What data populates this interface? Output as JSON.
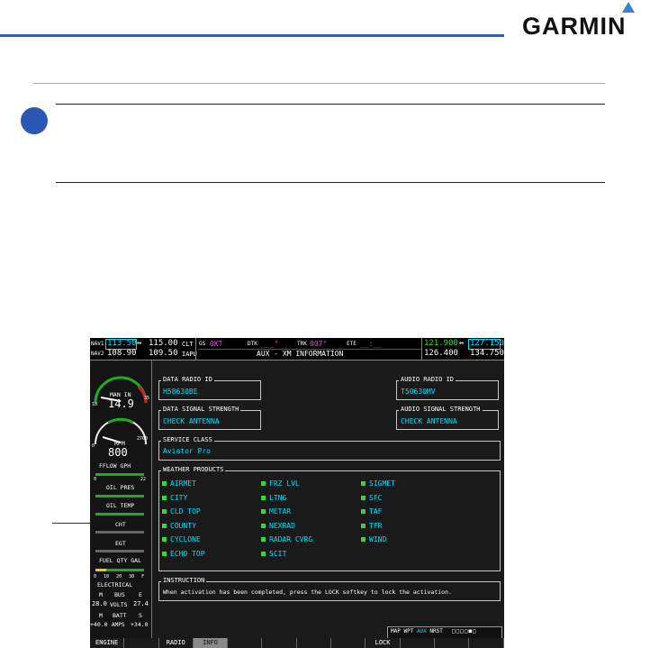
{
  "brand": {
    "logo": "GARMIN",
    "accent": "#3b5da8",
    "logo_mark": "triangle-icon"
  },
  "nav_bar": {
    "nav1_label": "NAV1",
    "nav1_active": "113.50",
    "nav1_swap": "↔",
    "nav1_standby": "115.00",
    "nav1_id": "CLT",
    "nav2_label": "NAV2",
    "nav2_active": "108.90",
    "nav2_standby": "109.50",
    "nav2_id": "IAPU",
    "gs_label": "GS",
    "gs_value": "0KT",
    "dtk_label": "DTK",
    "dtk_value": "___°",
    "trk_label": "TRK",
    "trk_value": "007°",
    "ete_label": "ETE",
    "ete_value": "__:__",
    "page_title": "AUX - XM INFORMATION",
    "com1_active": "121.900",
    "com1_swap": "↔",
    "com1_standby": "127.150",
    "com1_label": "COM1",
    "com2_active": "126.400",
    "com2_standby": "134.750",
    "com2_label": "COM2"
  },
  "eis": {
    "man_in_label": "MAN IN",
    "man_in_value": "14.9",
    "man_in_min": "10",
    "man_in_max": "35",
    "rpm_label": "RPM",
    "rpm_value": "800",
    "rpm_min": "0",
    "rpm_max": "2700",
    "fflow_label": "FFLOW GPH",
    "fflow_min": "0",
    "fflow_max": "22",
    "oil_pres_label": "OIL PRES",
    "oil_temp_label": "OIL TEMP",
    "cht_label": "CHT",
    "egt_label": "EGT",
    "fuel_label": "FUEL QTY GAL",
    "fuel_ticks": [
      "0",
      "10",
      "20",
      "30",
      "F"
    ],
    "elec_label": "ELECTRICAL",
    "bus_m": "M",
    "bus_label": "BUS",
    "bus_e": "E",
    "volts_m": "28.0",
    "volts_label": "VOLTS",
    "volts_e": "27.4",
    "batt_m": "M",
    "batt_label": "BATT",
    "batt_s": "S",
    "amps_m": "+40.0",
    "amps_label": "AMPS",
    "amps_s": "+34.0"
  },
  "xm": {
    "data_radio_id_label": "DATA RADIO ID",
    "data_radio_id": "H58630BE",
    "audio_radio_id_label": "AUDIO RADIO ID",
    "audio_radio_id": "T50630MV",
    "data_signal_label": "DATA SIGNAL STRENGTH",
    "data_signal": "CHECK ANTENNA",
    "audio_signal_label": "AUDIO SIGNAL STRENGTH",
    "audio_signal": "CHECK ANTENNA",
    "service_class_label": "SERVICE CLASS",
    "service_class": "Aviator Pro",
    "weather_label": "WEATHER PRODUCTS",
    "weather_products": [
      [
        "AIRMET",
        "FRZ LVL",
        "SIGMET"
      ],
      [
        "CITY",
        "LTNG",
        "SFC"
      ],
      [
        "CLD TOP",
        "METAR",
        "TAF"
      ],
      [
        "COUNTY",
        "NEXRAD",
        "TFR"
      ],
      [
        "CYCLONE",
        "RADAR CVRG",
        "WIND"
      ],
      [
        "ECHO TOP",
        "SCIT",
        ""
      ]
    ],
    "instruction_label": "INSTRUCTION",
    "instruction": "When activation has been completed, press the LOCK softkey to lock the activation."
  },
  "page_group": {
    "items": [
      "MAP",
      "WPT",
      "AUX",
      "NRST"
    ],
    "active": "AUX"
  },
  "softkeys": [
    "ENGINE",
    "",
    "RADIO",
    "INFO",
    "",
    "",
    "",
    "",
    "LOCK",
    "",
    "",
    ""
  ]
}
